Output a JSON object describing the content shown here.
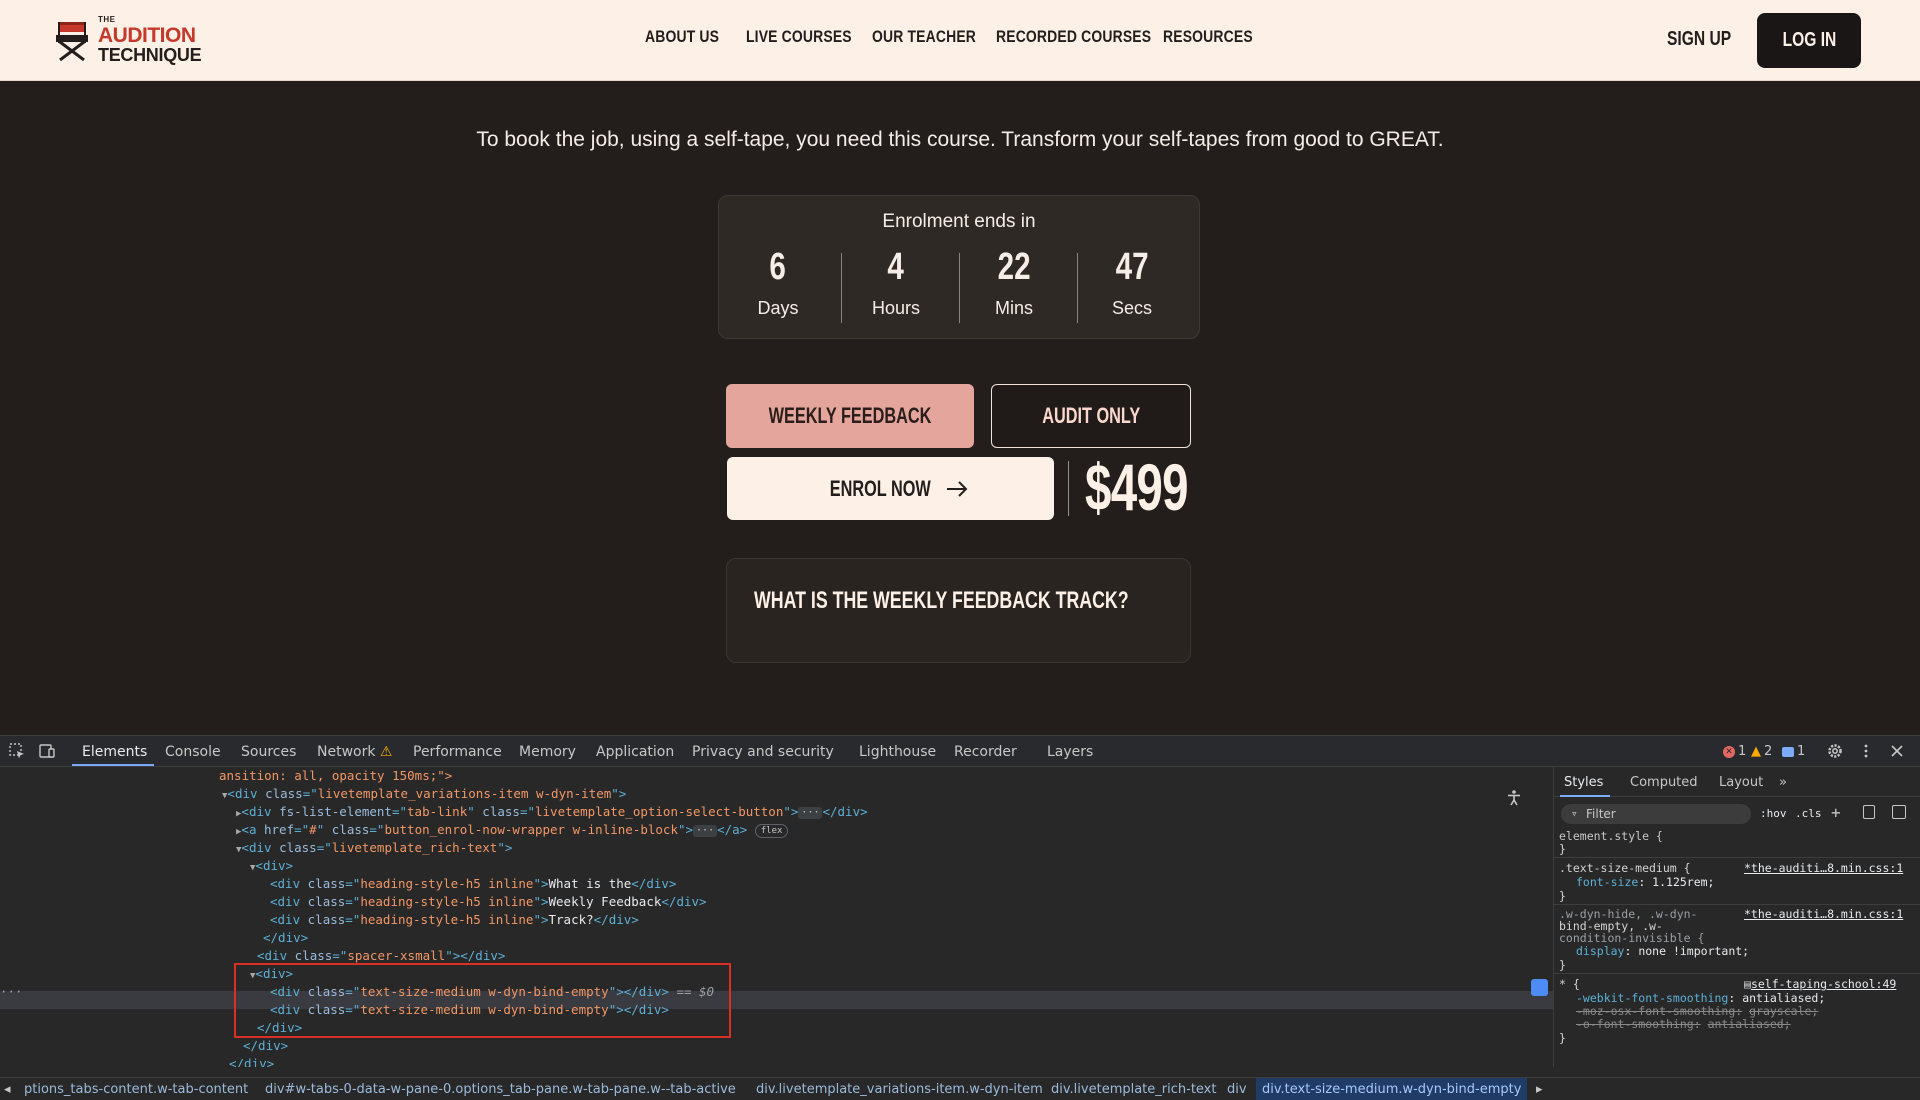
{
  "header": {
    "logo": {
      "the": "THE",
      "audition": "AUDITION",
      "technique": "TECHNIQUE"
    },
    "nav": [
      "ABOUT US",
      "LIVE COURSES",
      "OUR TEACHER",
      "RECORDED COURSES",
      "RESOURCES"
    ],
    "signup": "SIGN UP",
    "login": "LOG IN"
  },
  "main": {
    "tagline": "To book the job, using a self-tape, you need this course. Transform your self-tapes from good to GREAT.",
    "countdown": {
      "title": "Enrolment ends in",
      "cells": [
        {
          "value": "6",
          "unit": "Days"
        },
        {
          "value": "4",
          "unit": "Hours"
        },
        {
          "value": "22",
          "unit": "Mins"
        },
        {
          "value": "47",
          "unit": "Secs"
        }
      ]
    },
    "options": {
      "weekly": "WEEKLY FEEDBACK",
      "audit": "AUDIT ONLY"
    },
    "enrol": "ENROL NOW",
    "price": "$499",
    "faq_title": "WHAT IS THE WEEKLY FEEDBACK TRACK?"
  },
  "devtools": {
    "tabs": [
      "Elements",
      "Console",
      "Sources",
      "Network",
      "Performance",
      "Memory",
      "Application",
      "Privacy and security",
      "Lighthouse",
      "Recorder",
      "Layers"
    ],
    "status": {
      "errors": "1",
      "warnings": "2",
      "info": "1"
    },
    "dom": {
      "l0": "ansition: all, opacity 150ms;\">",
      "l1_tag": "div",
      "l1_cls": "livetemplate_variations-item w-dyn-item",
      "l2_attr1": "fs-list-element",
      "l2_val1": "tab-link",
      "l2_cls": "livetemplate_option-select-button",
      "l3_href": "#",
      "l3_cls": "button_enrol-now-wrapper w-inline-block",
      "l3_chip": "flex",
      "l4_cls": "livetemplate_rich-text",
      "h5_cls": "heading-style-h5 inline",
      "h5_t1": "What is the",
      "h5_t2": "Weekly Feedback",
      "h5_t3": "Track?",
      "spacer_cls": "spacer-xsmall",
      "bind_cls": "text-size-medium w-dyn-bind-empty",
      "selected_marker": "== $0"
    },
    "styles": {
      "tabs": [
        "Styles",
        "Computed",
        "Layout"
      ],
      "filter": "Filter",
      "hov": ":hov",
      "cls": ".cls",
      "element_style": "element.style {",
      "rule1_sel": ".text-size-medium {",
      "rule1_src": "*the-auditi…8.min.css:1",
      "rule1_prop": "font-size",
      "rule1_val": "1.125rem;",
      "rule2_sel_a": ".w-dyn-hide, .w-dyn-",
      "rule2_sel_b": "bind-empty, .w-",
      "rule2_sel_c": "condition-invisible {",
      "rule2_src": "*the-auditi…8.min.css:1",
      "rule2_prop": "display",
      "rule2_val": "none !important;",
      "rule3_sel": "* {",
      "rule3_src": "self-taping-school:49",
      "rule3_p1": "-webkit-font-smoothing",
      "rule3_v1": "antialiased;",
      "rule3_p2": "-moz-osx-font-smoothing:",
      "rule3_v2": "grayscale;",
      "rule3_p3": "-o-font-smoothing:",
      "rule3_v3": "antialiased;",
      "close_brace": "}"
    },
    "breadcrumbs": [
      "ptions_tabs-content.w-tab-content",
      "div#w-tabs-0-data-w-pane-0.options_tab-pane.w-tab-pane.w--tab-active",
      "div.livetemplate_variations-item.w-dyn-item",
      "div.livetemplate_rich-text",
      "div",
      "div.text-size-medium.w-dyn-bind-empty"
    ]
  }
}
